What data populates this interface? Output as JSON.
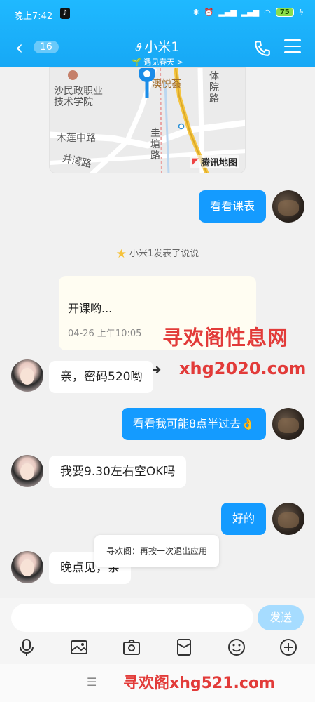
{
  "status_bar": {
    "time": "晚上7:42",
    "battery": "75"
  },
  "header": {
    "unread_count": "16",
    "contact_name": "小米1",
    "subtitle": "遇见春天 >",
    "colors": {
      "bar": "#1fb9ff",
      "accent": "#149bff"
    }
  },
  "map": {
    "labels": [
      "沙民政职业",
      "技术学院",
      "澳悦荟",
      "体",
      "院",
      "路",
      "木莲中路",
      "圭",
      "塘",
      "路",
      "井湾路"
    ],
    "brand": "腾讯地图"
  },
  "messages": [
    {
      "from": "me",
      "text": "看看课表"
    },
    {
      "from": "her",
      "text": "亲，密码520哟"
    },
    {
      "from": "me",
      "text": "看看我可能8点半过去👌"
    },
    {
      "from": "her",
      "text": "我要9.30左右空OK吗"
    },
    {
      "from": "me",
      "text": "好的"
    },
    {
      "from": "her",
      "text": "晚点见，亲"
    }
  ],
  "notice": "小米1发表了说说",
  "post": {
    "text": "开课哟...",
    "date": "04-26 上午10:05"
  },
  "watermark": {
    "title": "寻欢阁性息网",
    "url": "xhg2020.com",
    "footer": "寻欢阁xhg521.com"
  },
  "toast": "寻欢阁：再按一次退出应用",
  "composer": {
    "send_label": "发送",
    "placeholder": ""
  },
  "toolbar_icons": [
    "mic-icon",
    "image-icon",
    "camera-icon",
    "red-packet-icon",
    "emoji-icon",
    "plus-icon"
  ]
}
